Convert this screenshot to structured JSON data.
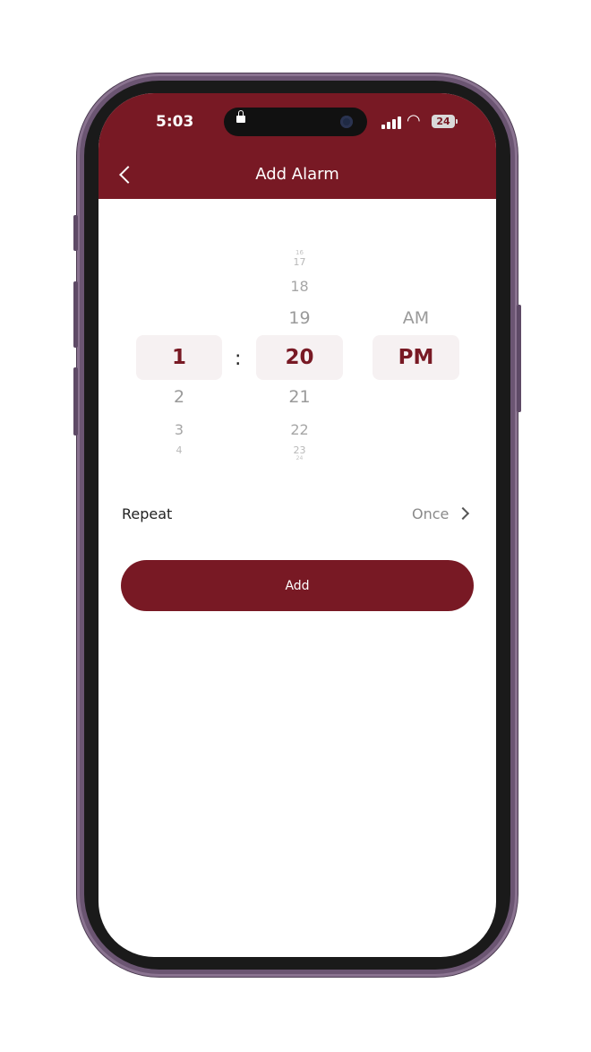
{
  "status_bar": {
    "time": "5:03",
    "battery": "24"
  },
  "header": {
    "title": "Add Alarm"
  },
  "picker": {
    "hour": {
      "above": [
        "",
        ""
      ],
      "selected": "1",
      "below": [
        "2",
        "3",
        "4"
      ]
    },
    "separator": ":",
    "minute": {
      "above": [
        "16",
        "17",
        "18",
        "19"
      ],
      "selected": "20",
      "below": [
        "21",
        "22",
        "23",
        "24"
      ]
    },
    "period": {
      "above": [
        "AM"
      ],
      "selected": "PM"
    }
  },
  "repeat": {
    "label": "Repeat",
    "value": "Once"
  },
  "add_button": {
    "label": "Add"
  },
  "colors": {
    "accent": "#781924",
    "selection_bg": "#f6f1f2",
    "frame": "#6b5572"
  }
}
